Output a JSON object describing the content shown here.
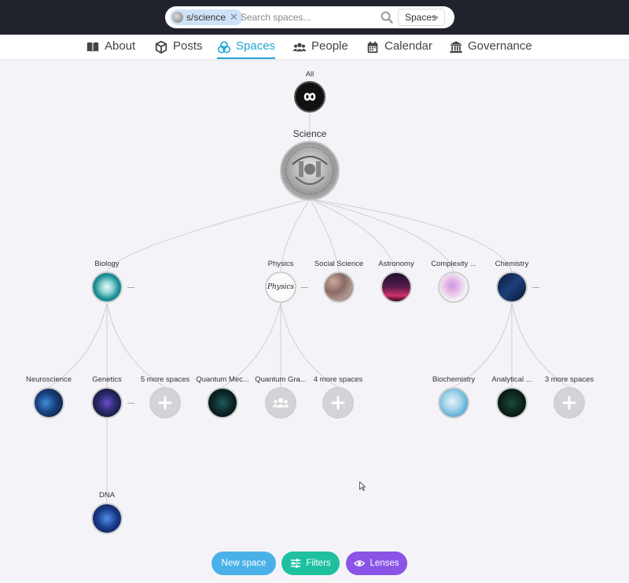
{
  "search": {
    "chip_label": "s/science",
    "placeholder": "Search spaces...",
    "scope": "Spaces"
  },
  "nav": [
    {
      "label": "About",
      "icon": "book-icon"
    },
    {
      "label": "Posts",
      "icon": "cube-icon"
    },
    {
      "label": "Spaces",
      "icon": "spaces-icon",
      "active": true
    },
    {
      "label": "People",
      "icon": "people-icon"
    },
    {
      "label": "Calendar",
      "icon": "calendar-icon"
    },
    {
      "label": "Governance",
      "icon": "bank-icon"
    }
  ],
  "tree": {
    "root": {
      "label": "All",
      "icon": "infinity-icon"
    },
    "current": {
      "label": "Science"
    },
    "children": [
      {
        "label": "Biology"
      },
      {
        "label": "Physics"
      },
      {
        "label": "Social Science"
      },
      {
        "label": "Astronomy"
      },
      {
        "label": "Complexity ..."
      },
      {
        "label": "Chemistry"
      }
    ],
    "grandchildren": [
      {
        "label": "Neuroscience"
      },
      {
        "label": "Genetics"
      },
      {
        "label": "5 more spaces"
      },
      {
        "label": "Quantum Mec..."
      },
      {
        "label": "Quantum Gra..."
      },
      {
        "label": "4 more spaces"
      },
      {
        "label": "Biochemistry"
      },
      {
        "label": "Analytical ..."
      },
      {
        "label": "3 more spaces"
      }
    ],
    "great_grandchildren": [
      {
        "label": "DNA"
      }
    ],
    "physics_image_text": "Physics"
  },
  "actions": {
    "new_space": "New space",
    "filters": "Filters",
    "lenses": "Lenses"
  },
  "colors": {
    "topbar": "#20232c",
    "accent": "#22a6d6",
    "new_space": "#49b1e8",
    "filters": "#1ec0a0",
    "lenses": "#8a55e6"
  }
}
